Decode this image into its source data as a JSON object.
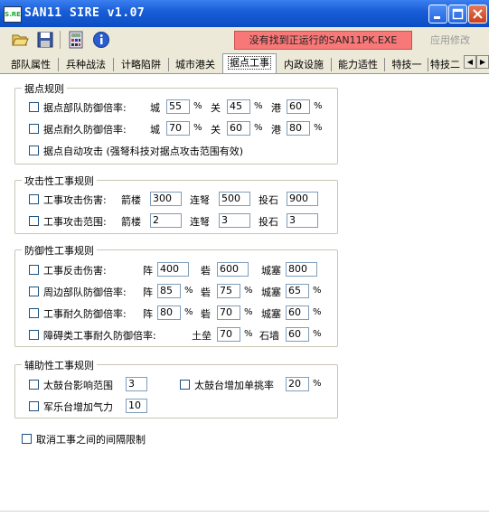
{
  "window": {
    "title": "SAN11 SIRE v1.07",
    "icon_text": "S.RE"
  },
  "toolbar": {
    "status_text": "没有找到正运行的SAN11PK.EXE",
    "apply_label": "应用修改",
    "icons": [
      "open-folder-icon",
      "save-icon",
      "calculator-icon",
      "info-icon"
    ]
  },
  "tabs": [
    {
      "label": "部队属性",
      "active": false
    },
    {
      "label": "兵种战法",
      "active": false
    },
    {
      "label": "计略陷阱",
      "active": false
    },
    {
      "label": "城市港关",
      "active": false
    },
    {
      "label": "据点工事",
      "active": true
    },
    {
      "label": "内政设施",
      "active": false
    },
    {
      "label": "能力适性",
      "active": false
    },
    {
      "label": "特技一",
      "active": false
    },
    {
      "label": "特技二",
      "active": false
    }
  ],
  "groups": {
    "stronghold": {
      "title": "据点规则",
      "row1": {
        "label": "据点部队防御倍率:",
        "city_label": "城",
        "city": "55",
        "pass_label": "关",
        "pass": "45",
        "port_label": "港",
        "port": "60"
      },
      "row2": {
        "label": "据点耐久防御倍率:",
        "city_label": "城",
        "city": "70",
        "pass_label": "关",
        "pass": "60",
        "port_label": "港",
        "port": "80"
      },
      "row3": {
        "label": "据点自动攻击 (强弩科技对据点攻击范围有效)"
      }
    },
    "attack": {
      "title": "攻击性工事规则",
      "row1": {
        "label": "工事攻击伤害:",
        "a_label": "箭楼",
        "a": "300",
        "b_label": "连弩",
        "b": "500",
        "c_label": "投石",
        "c": "900"
      },
      "row2": {
        "label": "工事攻击范围:",
        "a_label": "箭楼",
        "a": "2",
        "b_label": "连弩",
        "b": "3",
        "c_label": "投石",
        "c": "3"
      }
    },
    "defense": {
      "title": "防御性工事规则",
      "row1": {
        "label": "工事反击伤害:",
        "a_label": "阵",
        "a": "400",
        "b_label": "砦",
        "b": "600",
        "c_label": "城塞",
        "c": "800"
      },
      "row2": {
        "label": "周边部队防御倍率:",
        "a_label": "阵",
        "a": "85",
        "b_label": "砦",
        "b": "75",
        "c_label": "城塞",
        "c": "65"
      },
      "row3": {
        "label": "工事耐久防御倍率:",
        "a_label": "阵",
        "a": "80",
        "b_label": "砦",
        "b": "70",
        "c_label": "城塞",
        "c": "60"
      },
      "row4": {
        "label": "障碍类工事耐久防御倍率:",
        "a_label": "土垒",
        "a": "70",
        "b_label": "石墙",
        "b": "60"
      }
    },
    "aux": {
      "title": "辅助性工事规则",
      "row1": {
        "label": "太鼓台影响范围",
        "value": "3"
      },
      "row2": {
        "label": "太鼓台增加单挑率",
        "value": "20"
      },
      "row3": {
        "label": "军乐台增加气力",
        "value": "10"
      }
    }
  },
  "bottom": {
    "label": "取消工事之间的间隔限制"
  },
  "percent": "%",
  "colors": {
    "titlebar": "#0a4cc4",
    "status_bg": "#f87878",
    "toolbar_bg": "#ece9d8"
  }
}
